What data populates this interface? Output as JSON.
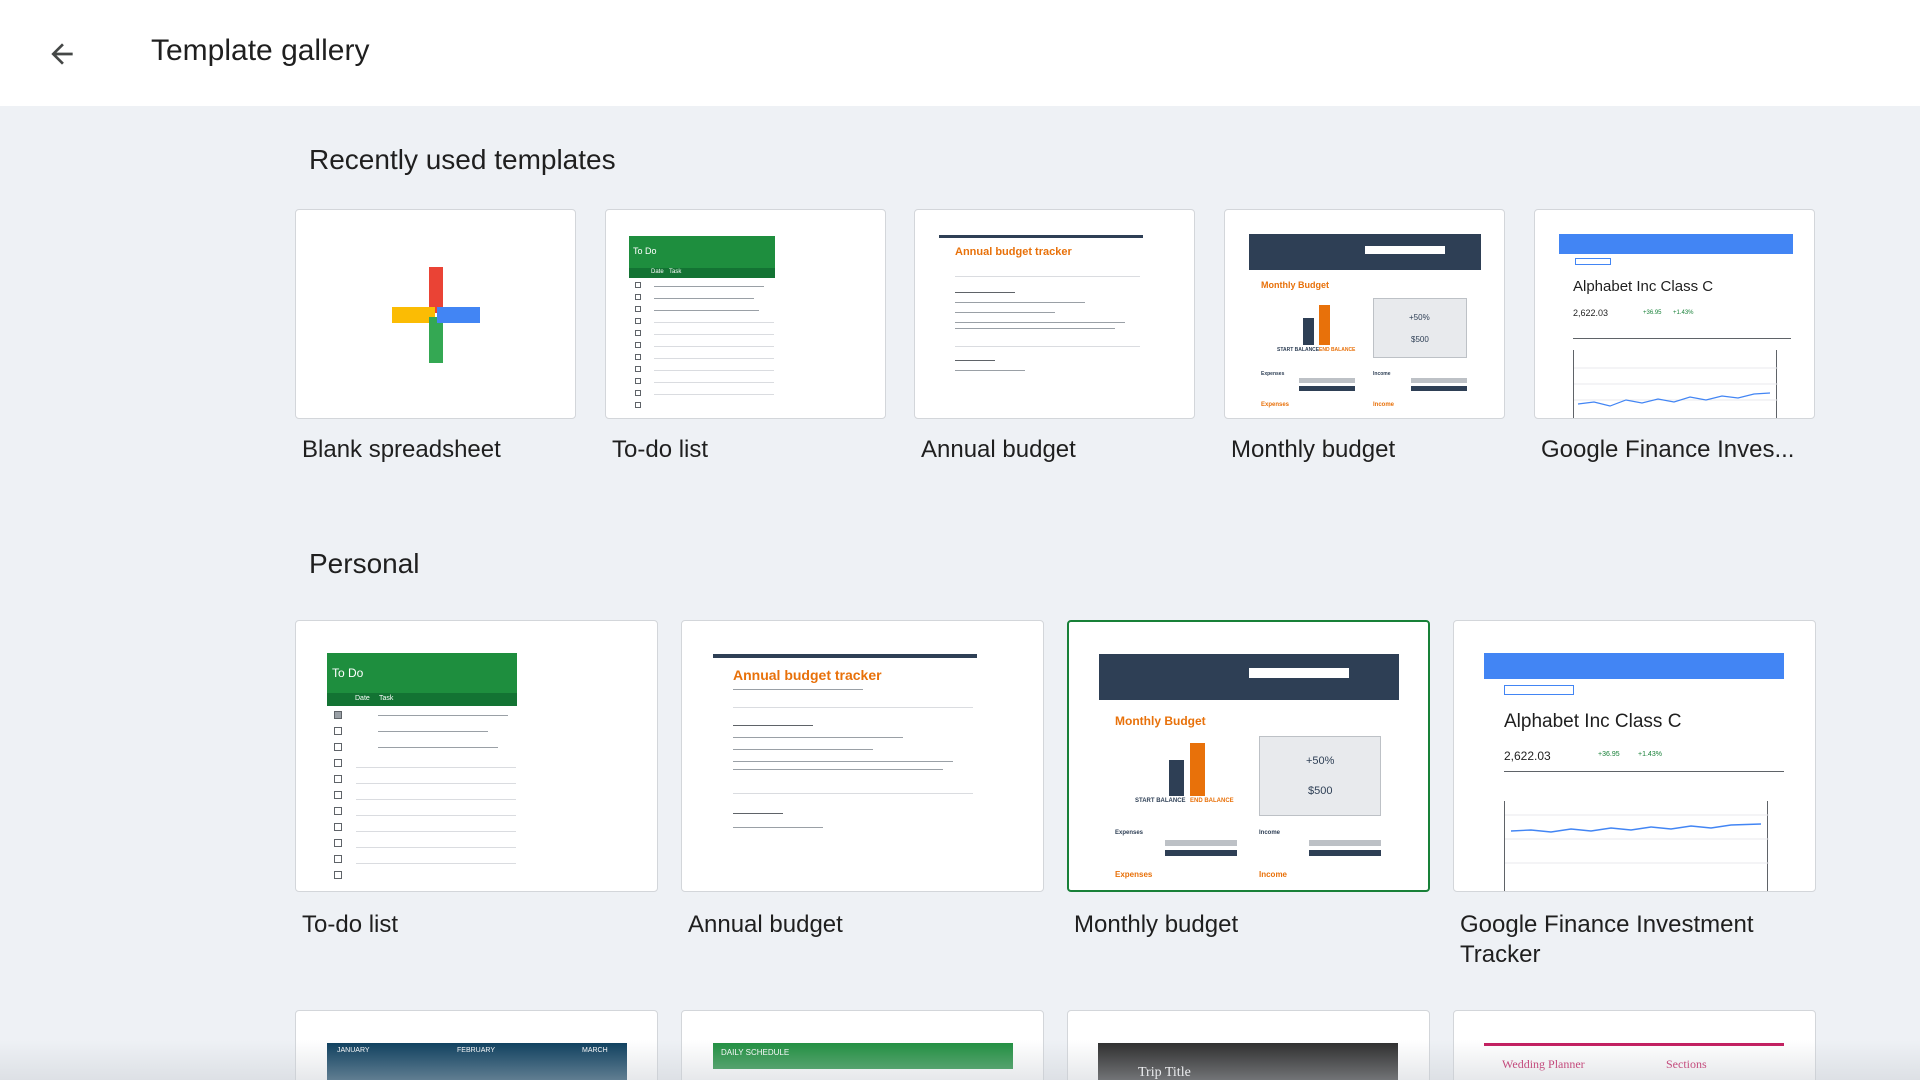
{
  "header": {
    "title": "Template gallery",
    "back_icon": "arrow-back-icon"
  },
  "recent": {
    "title": "Recently used templates",
    "items": [
      {
        "label": "Blank spreadsheet"
      },
      {
        "label": "To-do list"
      },
      {
        "label": "Annual budget"
      },
      {
        "label": "Monthly budget"
      },
      {
        "label": "Google Finance Inves..."
      }
    ]
  },
  "personal": {
    "title": "Personal",
    "items": [
      {
        "label": "To-do list"
      },
      {
        "label": "Annual budget"
      },
      {
        "label": "Monthly budget"
      },
      {
        "label": "Google Finance Investment Tracker"
      }
    ]
  },
  "thumbs": {
    "todo_title": "To Do",
    "todo_date_col": "Date",
    "todo_task_col": "Task",
    "annual_title": "Annual budget tracker",
    "monthly_title": "Monthly Budget",
    "monthly_start": "START BALANCE",
    "monthly_end": "END BALANCE",
    "monthly_pct": "+50%",
    "monthly_saved": "$500",
    "monthly_expenses": "Expenses",
    "monthly_income": "Income",
    "finance_title": "Alphabet Inc Class C",
    "finance_price": "2,622.03",
    "finance_change": "+36.95",
    "finance_pct": "+1.43%",
    "cal_jan": "JANUARY",
    "cal_feb": "FEBRUARY",
    "cal_mar": "MARCH",
    "schedule_title": "DAILY SCHEDULE",
    "trip_title": "Trip Title",
    "wedding_title": "Wedding Planner",
    "wedding_sections": "Sections"
  },
  "colors": {
    "selected_border": "#188038",
    "todo_green": "#1e8e3e",
    "budget_orange": "#e8710a",
    "budget_navy": "#2e3f55",
    "finance_blue": "#4285f4",
    "wedding_pink": "#c2185b"
  }
}
